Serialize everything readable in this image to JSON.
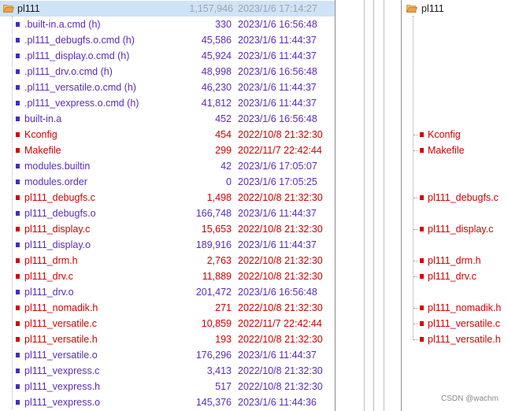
{
  "left": {
    "folder": {
      "icon": "folder-open-icon",
      "name": "pl111",
      "size": "1,157,946",
      "date": "2023/1/6 17:14:27"
    },
    "files": [
      {
        "name": ".built-in.a.cmd (h)",
        "size": "330",
        "date": "2023/1/6 16:56:48",
        "color": "purple"
      },
      {
        "name": ".pl111_debugfs.o.cmd (h)",
        "size": "45,586",
        "date": "2023/1/6 11:44:37",
        "color": "purple"
      },
      {
        "name": ".pl111_display.o.cmd (h)",
        "size": "45,924",
        "date": "2023/1/6 11:44:37",
        "color": "purple"
      },
      {
        "name": ".pl111_drv.o.cmd (h)",
        "size": "48,998",
        "date": "2023/1/6 16:56:48",
        "color": "purple"
      },
      {
        "name": ".pl111_versatile.o.cmd (h)",
        "size": "46,230",
        "date": "2023/1/6 11:44:37",
        "color": "purple"
      },
      {
        "name": ".pl111_vexpress.o.cmd (h)",
        "size": "41,812",
        "date": "2023/1/6 11:44:37",
        "color": "purple"
      },
      {
        "name": "built-in.a",
        "size": "452",
        "date": "2023/1/6 16:56:48",
        "color": "purple"
      },
      {
        "name": "Kconfig",
        "size": "454",
        "date": "2022/10/8 21:32:30",
        "color": "red"
      },
      {
        "name": "Makefile",
        "size": "299",
        "date": "2022/11/7 22:42:44",
        "color": "red"
      },
      {
        "name": "modules.builtin",
        "size": "42",
        "date": "2023/1/6 17:05:07",
        "color": "purple"
      },
      {
        "name": "modules.order",
        "size": "0",
        "date": "2023/1/6 17:05:25",
        "color": "purple"
      },
      {
        "name": "pl111_debugfs.c",
        "size": "1,498",
        "date": "2022/10/8 21:32:30",
        "color": "red"
      },
      {
        "name": "pl111_debugfs.o",
        "size": "166,748",
        "date": "2023/1/6 11:44:37",
        "color": "purple"
      },
      {
        "name": "pl111_display.c",
        "size": "15,653",
        "date": "2022/10/8 21:32:30",
        "color": "red"
      },
      {
        "name": "pl111_display.o",
        "size": "189,916",
        "date": "2023/1/6 11:44:37",
        "color": "purple"
      },
      {
        "name": "pl111_drm.h",
        "size": "2,763",
        "date": "2022/10/8 21:32:30",
        "color": "red"
      },
      {
        "name": "pl111_drv.c",
        "size": "11,889",
        "date": "2022/10/8 21:32:30",
        "color": "red"
      },
      {
        "name": "pl111_drv.o",
        "size": "201,472",
        "date": "2023/1/6 16:56:48",
        "color": "purple"
      },
      {
        "name": "pl111_nomadik.h",
        "size": "271",
        "date": "2022/10/8 21:32:30",
        "color": "red"
      },
      {
        "name": "pl111_versatile.c",
        "size": "10,859",
        "date": "2022/11/7 22:42:44",
        "color": "red"
      },
      {
        "name": "pl111_versatile.h",
        "size": "193",
        "date": "2022/10/8 21:32:30",
        "color": "red"
      },
      {
        "name": "pl111_versatile.o",
        "size": "176,296",
        "date": "2023/1/6 11:44:37",
        "color": "purple"
      },
      {
        "name": "pl111_vexpress.c",
        "size": "3,413",
        "date": "2022/10/8 21:32:30",
        "color": "purple"
      },
      {
        "name": "pl111_vexpress.h",
        "size": "517",
        "date": "2022/10/8 21:32:30",
        "color": "purple"
      },
      {
        "name": "pl111_vexpress.o",
        "size": "145,376",
        "date": "2023/1/6 11:44:36",
        "color": "purple"
      }
    ]
  },
  "right": {
    "folder": {
      "icon": "folder-open-icon",
      "name": "pl111"
    },
    "files": [
      {
        "row": 7,
        "name": "Kconfig"
      },
      {
        "row": 8,
        "name": "Makefile"
      },
      {
        "row": 11,
        "name": "pl111_debugfs.c"
      },
      {
        "row": 13,
        "name": "pl111_display.c"
      },
      {
        "row": 15,
        "name": "pl111_drm.h"
      },
      {
        "row": 16,
        "name": "pl111_drv.c"
      },
      {
        "row": 18,
        "name": "pl111_nomadik.h"
      },
      {
        "row": 19,
        "name": "pl111_versatile.c"
      },
      {
        "row": 20,
        "name": "pl111_versatile.h"
      }
    ]
  },
  "watermark": "CSDN @wachm",
  "colors": {
    "purple": "#5b2cb8",
    "red": "#d40000",
    "selection": "#cfe3f7"
  }
}
